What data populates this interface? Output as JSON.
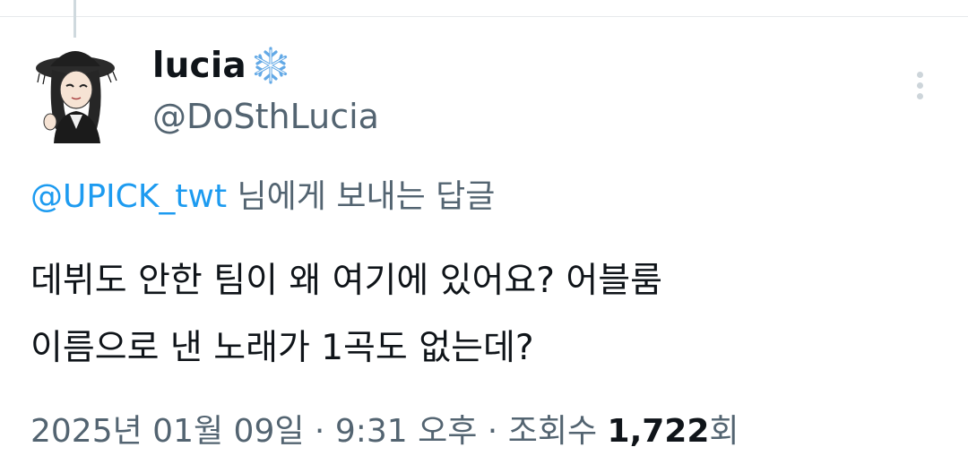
{
  "tweet": {
    "display_name": "lucia",
    "name_emoji": "snowflake-icon",
    "handle": "@DoSthLucia",
    "reply_mention": "@UPICK_twt",
    "reply_suffix": " 님에게 보내는 답글",
    "text_line1": "데뷔도 안한 팀이 왜 여기에 있어요? 어블룸",
    "text_line2": "이름으로 낸 노래가 1곡도 없는데?",
    "date": "2025년 01월 09일",
    "separator": " · ",
    "time": "9:31 오후",
    "views_label": "조회수 ",
    "views_count": "1,722",
    "views_suffix": "회"
  },
  "colors": {
    "link": "#1d9bf0",
    "secondary_text": "#536471",
    "primary_text": "#0f1419"
  }
}
